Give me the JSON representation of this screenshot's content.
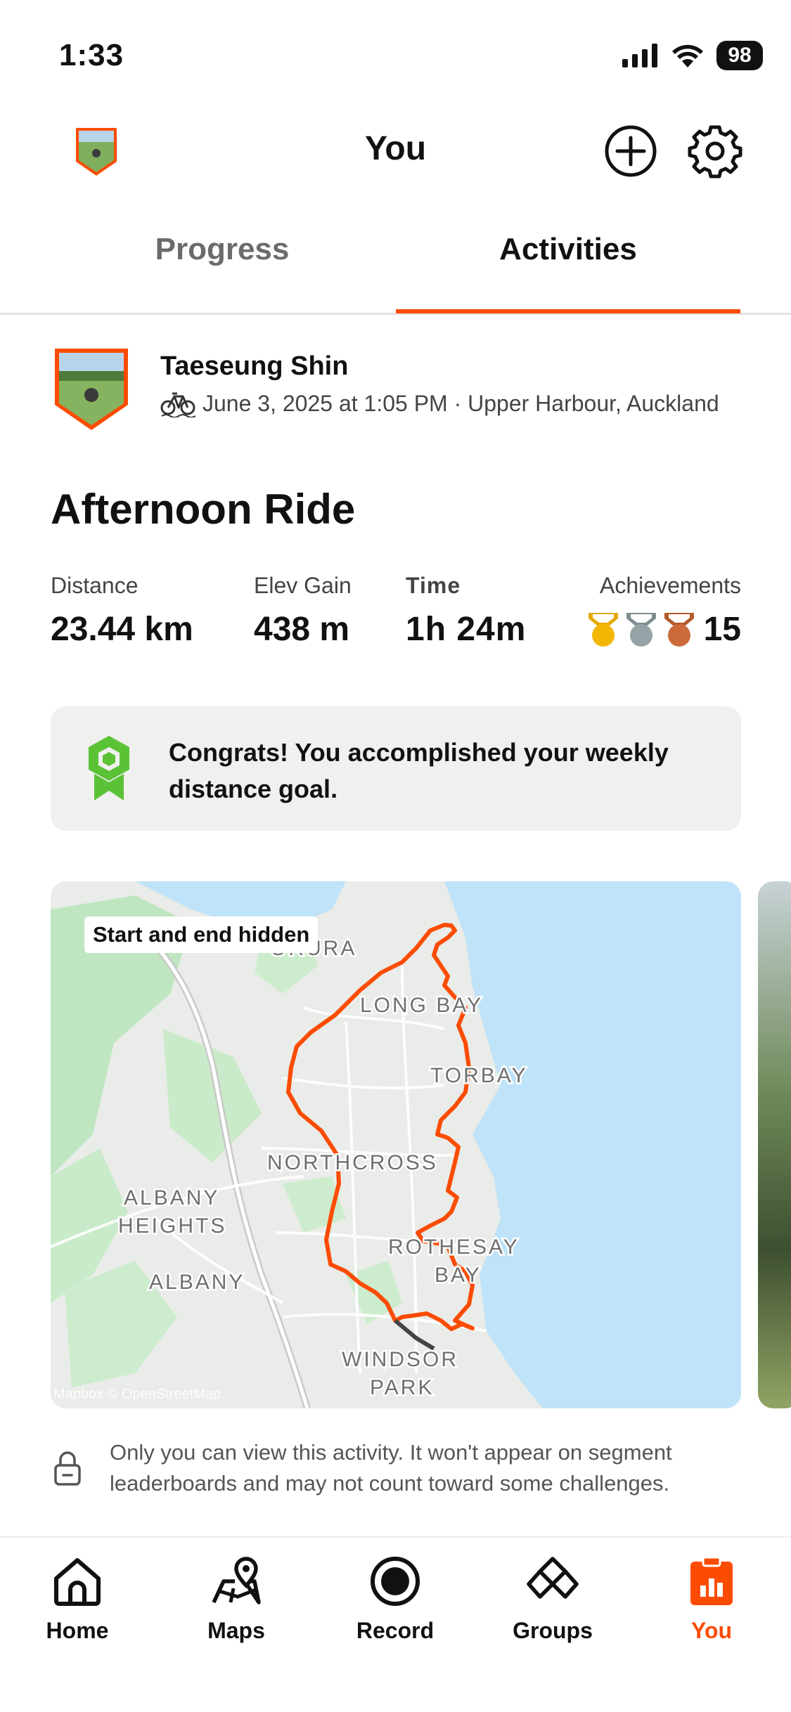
{
  "status_bar": {
    "time": "1:33",
    "battery": "98"
  },
  "header": {
    "title": "You"
  },
  "tabs": [
    {
      "label": "Progress",
      "active": false
    },
    {
      "label": "Activities",
      "active": true
    }
  ],
  "activity": {
    "athlete_name": "Taeseung Shin",
    "meta": "June 3, 2025 at 1:05 PM · Upper Harbour, Auckland",
    "sport_icon": "bike-icon",
    "title": "Afternoon Ride",
    "stats": {
      "distance_label": "Distance",
      "distance_value": "23.44 km",
      "elev_label": "Elev Gain",
      "elev_value": "438 m",
      "time_label": "Time",
      "time_value": "1h 24m",
      "achievements_label": "Achievements",
      "achievements_value": "15"
    },
    "medals": [
      "gold",
      "silver",
      "bronze"
    ]
  },
  "congrats": {
    "message": "Congrats! You accomplished your weekly distance goal."
  },
  "map": {
    "badge": "Start and end hidden",
    "attribution": "Mapbox © OpenStreetMap",
    "labels": {
      "orewa": "ORURA",
      "long_bay": "LONG BAY",
      "torbay": "TORBAY",
      "northcross": "NORTHCROSS",
      "albany_heights_1": "ALBANY",
      "albany_heights_2": "HEIGHTS",
      "albany": "ALBANY",
      "rothesay_1": "ROTHESAY",
      "rothesay_2": "BAY",
      "windsor_1": "WINDSOR",
      "windsor_2": "PARK"
    }
  },
  "privacy": {
    "text": "Only you can view this activity. It won't appear on segment leaderboards and may not count toward some challenges."
  },
  "tabbar": [
    {
      "label": "Home",
      "icon": "home-icon",
      "active": false
    },
    {
      "label": "Maps",
      "icon": "maps-icon",
      "active": false
    },
    {
      "label": "Record",
      "icon": "record-icon",
      "active": false
    },
    {
      "label": "Groups",
      "icon": "groups-icon",
      "active": false
    },
    {
      "label": "You",
      "icon": "you-icon",
      "active": true
    }
  ],
  "colors": {
    "accent": "#fc4c02",
    "goal_green": "#5bc236",
    "water": "#bfe3f8",
    "land": "#e9ece9",
    "park": "#bfe6c0"
  }
}
